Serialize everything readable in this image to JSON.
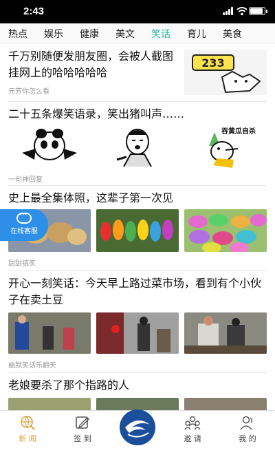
{
  "status": {
    "time": "2:43"
  },
  "tabs": [
    "热点",
    "娱乐",
    "健康",
    "美文",
    "笑话",
    "育儿",
    "美食"
  ],
  "active_tab": "笑话",
  "articles": [
    {
      "title": "千万别随便发朋友圈，会被人截图挂网上的哈哈哈哈哈",
      "source": "元芳你怎么看",
      "thumb_text": "233"
    },
    {
      "title": "二十五条爆笑语录，笑出猪叫声……",
      "source": "一句神回复",
      "sticker_text": "吞黄瓜自杀"
    },
    {
      "title": "史上最全集体照，这辈子第一次见",
      "source": "甜甜搞笑"
    },
    {
      "title": "开心一刻笑话：今天早上路过菜市场，看到有个小伙子在卖土豆",
      "source": "幽默笑话乐翻天"
    },
    {
      "title": "老娘要杀了那个指路的人"
    }
  ],
  "float_service": {
    "label": "在线客服"
  },
  "nav": [
    {
      "label": "新 闻",
      "icon": "globe-icon"
    },
    {
      "label": "签 到",
      "icon": "edit-icon"
    },
    {
      "label": "",
      "icon": "app-logo"
    },
    {
      "label": "邀 请",
      "icon": "people-icon"
    },
    {
      "label": "我 的",
      "icon": "user-icon"
    }
  ],
  "colors": {
    "accent": "#2cb5a0",
    "nav_active": "#d9a040",
    "service": "#2e8fe8"
  }
}
